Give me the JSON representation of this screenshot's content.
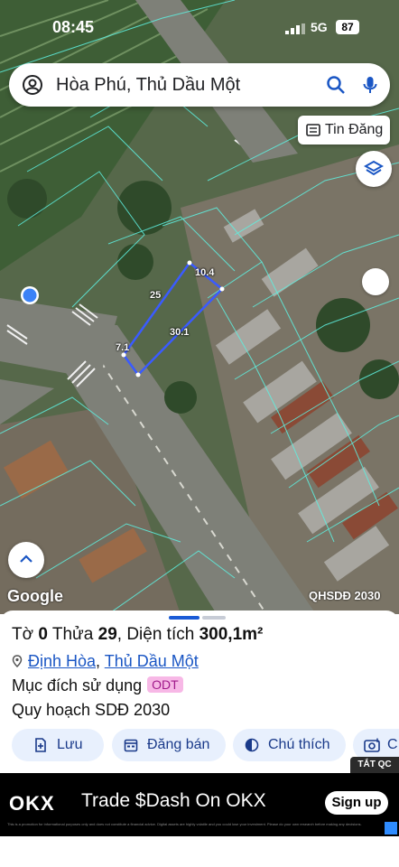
{
  "status_bar": {
    "time": "08:45",
    "network": "5G",
    "battery": "87"
  },
  "search": {
    "query": "Hòa Phú, Thủ Dầu Một"
  },
  "tin_dang": {
    "label": "Tin Đăng"
  },
  "map": {
    "google_label": "Google",
    "layer_label": "QHSDĐ 2030",
    "dimensions": {
      "top": "10.4",
      "left": "25",
      "right": "30.1",
      "bottom": "7.1"
    }
  },
  "parcel": {
    "sheet_label": "Tờ",
    "sheet_no": "0",
    "plot_label": "Thửa",
    "plot_no": "29",
    "area_label": "Diện tích",
    "area_value": "300,1m²",
    "ward": "Định Hòa",
    "separator": ",",
    "city": "Thủ Dầu Một",
    "purpose_label": "Mục đích sử dụng",
    "purpose_code": "ODT",
    "plan_label": "Quy hoạch SDĐ 2030"
  },
  "actions": [
    {
      "label": "Lưu",
      "icon": "plus-doc-icon"
    },
    {
      "label": "Đăng bán",
      "icon": "calendar-icon"
    },
    {
      "label": "Chú thích",
      "icon": "half-circle-icon"
    },
    {
      "label": "C",
      "icon": "camera-icon"
    }
  ],
  "tat_qc": "TẮT QC",
  "ad": {
    "logo": "OKX",
    "headline": "Trade $Dash On OKX",
    "button": "Sign up",
    "fine_print": "This is a promotion for informational purposes only and does not constitute a financial advice. Digital assets are highly volatile and you could lose your investment. Please do your own research before making any decisions."
  },
  "colors": {
    "accent": "#1a56c4",
    "badge_bg": "#f7b8e6",
    "parcel_outline": "#3a5bff",
    "map_lines": "#5ef0e0"
  }
}
